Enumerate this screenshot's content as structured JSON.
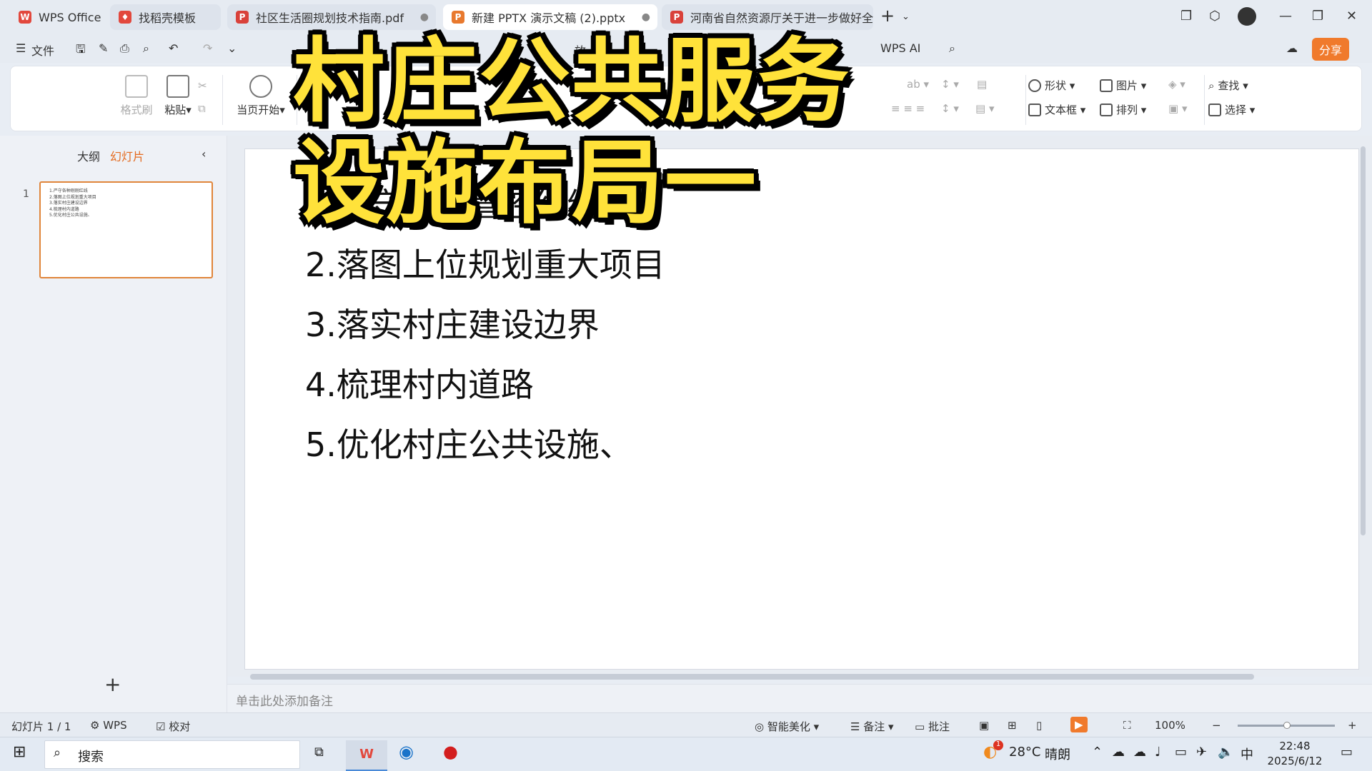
{
  "tabs": [
    {
      "label": "WPS Office",
      "icon": "wps-logo-icon",
      "color": "#e2483d"
    },
    {
      "label": "找稻壳模板",
      "icon": "docer-icon",
      "color": "#e2483d"
    },
    {
      "label": "社区生活圈规划技术指南.pdf",
      "icon": "pdf-icon",
      "color": "#d9413a"
    },
    {
      "label": "新建 PPTX 演示文稿 (2).pptx",
      "icon": "pptx-icon",
      "color": "#e8792e"
    },
    {
      "label": "河南省自然资源厅关于进一步做好全",
      "icon": "pdf-icon",
      "color": "#d9413a"
    }
  ],
  "menu": {
    "file": "文件",
    "items_partial": [
      "画",
      "放"
    ],
    "wps_ai": "WPS AI",
    "share": "分享"
  },
  "ribbon": {
    "format_painter": "格式刷",
    "paste": "粘贴",
    "play_from_current": "当页开始",
    "shape": "形状",
    "picture": "图片",
    "textbox": "文本框",
    "arrange": "排列",
    "find": "查找",
    "select": "选择"
  },
  "left_panel": {
    "tab_outline": "大纲",
    "tab_slides": "幻灯片",
    "slide_number": "1",
    "thumb_lines": [
      "1.严守各种刚刚红线",
      "2.落图上位规划重大项目",
      "3.落实村庄建设边界",
      "4.梳理村内道路",
      "5.优化村庄公共设施、"
    ]
  },
  "slide": {
    "lines": [
      "1.严守各类管控红线",
      "2.落图上位规划重大项目",
      "3.落实村庄建设边界",
      "4.梳理村内道路",
      "5.优化村庄公共设施、"
    ]
  },
  "overlay": {
    "line1": "村庄公共服务",
    "line2": "设施布局一"
  },
  "notes_placeholder": "单击此处添加备注",
  "status": {
    "slide_count": "幻灯片 1 / 1",
    "wps": "WPS",
    "proofread": "校对",
    "beautify": "智能美化",
    "notes": "备注",
    "comments": "批注",
    "zoom": "100%"
  },
  "taskbar": {
    "search": "搜索",
    "weather_temp": "28°C",
    "weather_desc": "晴朗",
    "ime": "中",
    "time": "22:48",
    "date": "2025/6/12",
    "weather_badge": "1"
  },
  "colors": {
    "accent_orange": "#e46a1e",
    "share_button": "#f07a2c",
    "overlay_yellow": "#ffe23a"
  }
}
